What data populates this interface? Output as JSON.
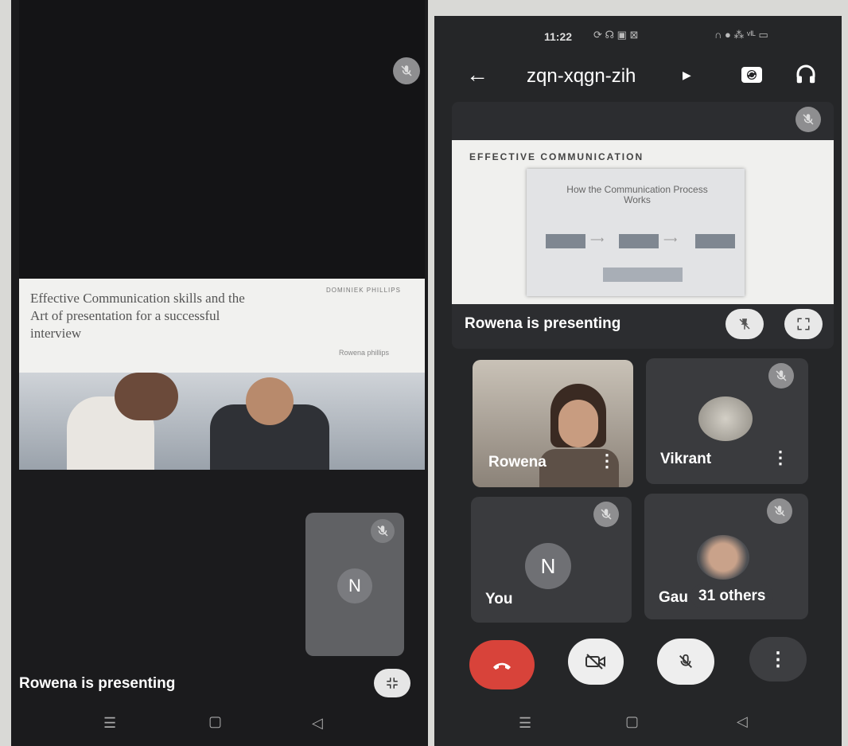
{
  "left": {
    "slide": {
      "title_line1": "Effective Communication skills and the",
      "title_line2": "Art of presentation for a successful",
      "title_line3": "interview",
      "logo_text": "DOMINIEK PHILLIPS",
      "presenter_name": "Rowena phillips"
    },
    "self_tile": {
      "avatar_letter": "N"
    },
    "presenting_label": "Rowena is presenting"
  },
  "right": {
    "status_bar": {
      "time": "11:22"
    },
    "header": {
      "meeting_code": "zqn-xqgn-zih"
    },
    "presentation": {
      "slide_heading": "EFFECTIVE COMMUNICATION",
      "diagram_title": "How the Communication Process Works",
      "presenting_label": "Rowena is presenting"
    },
    "participants": [
      {
        "name": "Rowena"
      },
      {
        "name": "Vikrant"
      },
      {
        "name": "You",
        "avatar_letter": "N"
      },
      {
        "name": "Gau",
        "others_label": "31 others"
      }
    ]
  },
  "colors": {
    "end_call": "#d8433a",
    "tile_bg": "#3a3b3e",
    "page_bg": "#252628"
  }
}
